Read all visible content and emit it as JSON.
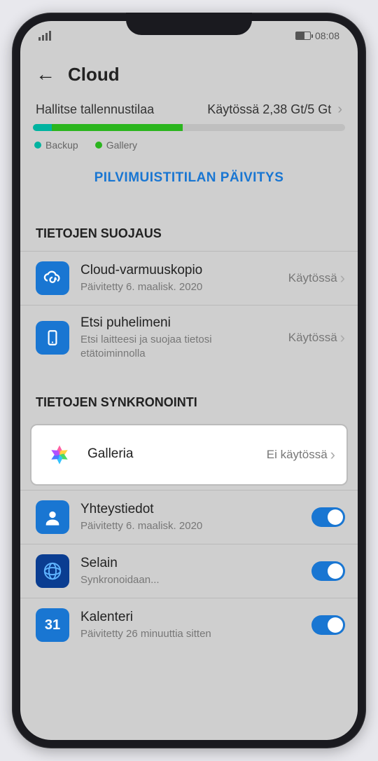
{
  "status": {
    "time": "08:08"
  },
  "header": {
    "title": "Cloud"
  },
  "storage": {
    "label": "Hallitse tallennustilaa",
    "usage": "Käytössä 2,38 Gt/5 Gt",
    "backup_pct": 6,
    "gallery_pct": 42,
    "legend_backup": "Backup",
    "legend_gallery": "Gallery"
  },
  "upgrade_label": "PILVIMUISTITILAN PÄIVITYS",
  "groups": {
    "protection": {
      "title": "TIETOJEN SUOJAUS",
      "items": [
        {
          "title": "Cloud-varmuuskopio",
          "sub": "Päivitetty 6. maalisk. 2020",
          "status": "Käytössä"
        },
        {
          "title": "Etsi puhelimeni",
          "sub": "Etsi laitteesi ja suojaa tietosi etätoiminnolla",
          "status": "Käytössä"
        }
      ]
    },
    "sync": {
      "title": "TIETOJEN SYNKRONOINTI",
      "items": [
        {
          "title": "Galleria",
          "status": "Ei käytössä"
        },
        {
          "title": "Yhteystiedot",
          "sub": "Päivitetty 6. maalisk. 2020"
        },
        {
          "title": "Selain",
          "sub": "Synkronoidaan..."
        },
        {
          "title": "Kalenteri",
          "sub": "Päivitetty 26 minuuttia sitten",
          "day": "31"
        }
      ]
    }
  }
}
